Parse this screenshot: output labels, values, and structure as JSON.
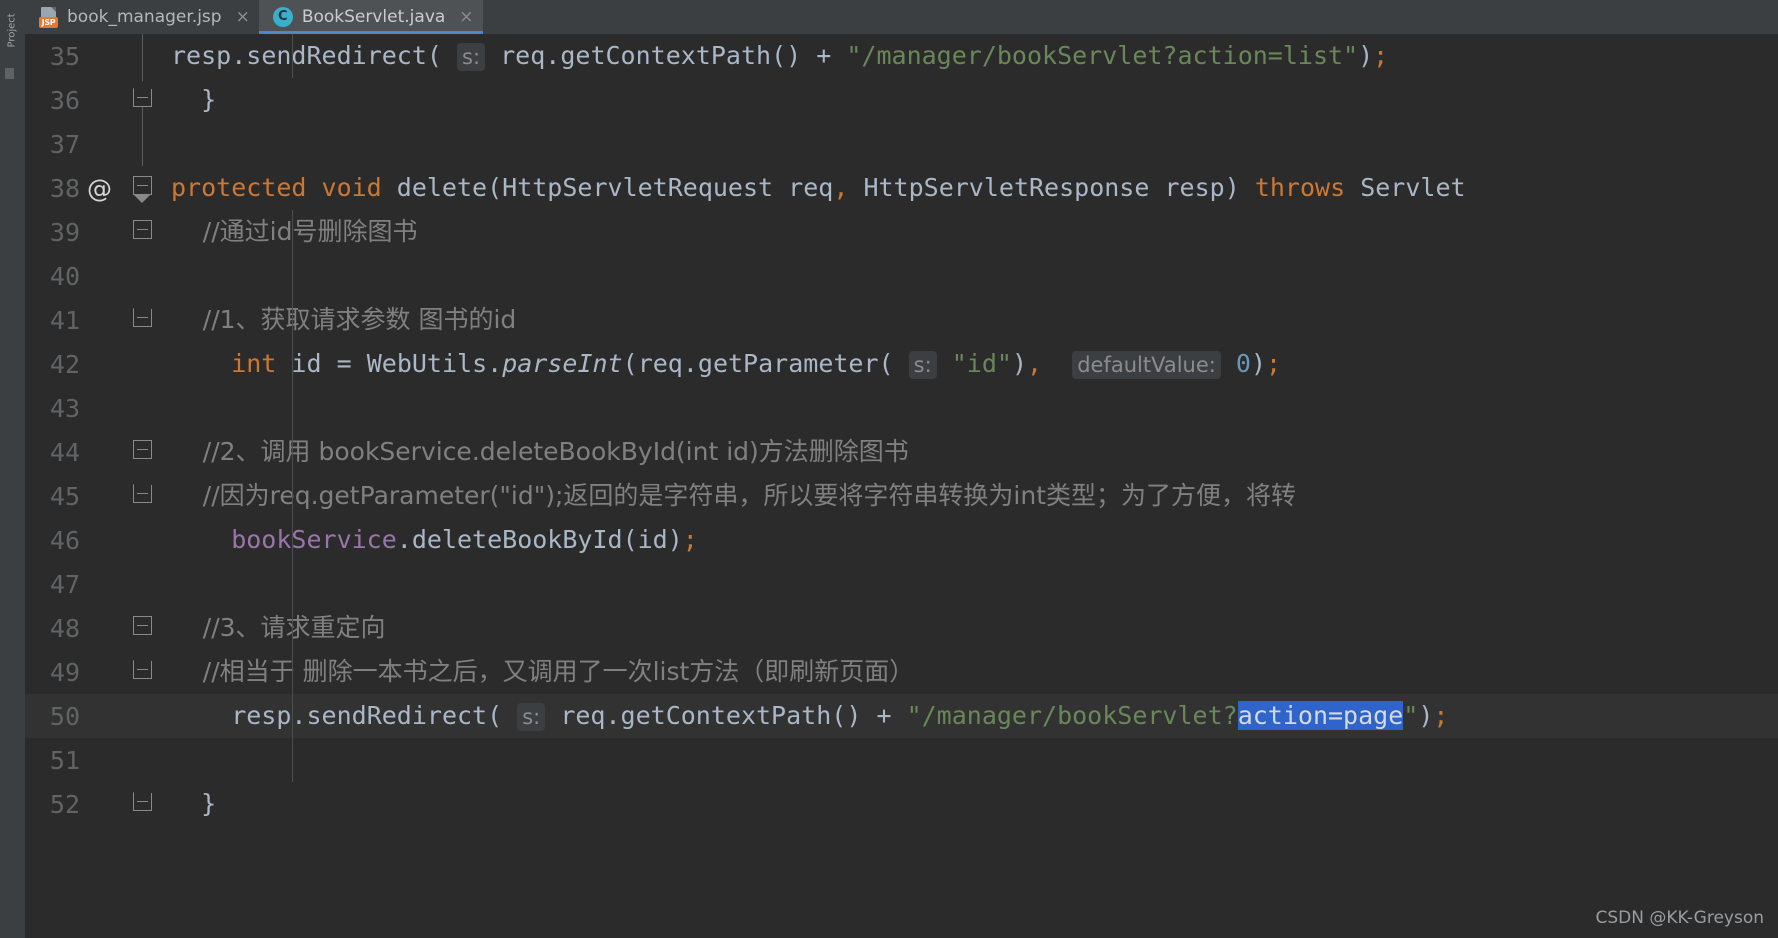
{
  "window": {
    "tool_stripe_label": "Project",
    "watermark": "CSDN @KK-Greyson"
  },
  "tabs": [
    {
      "label": "book_manager.jsp",
      "icon": "jsp-file-icon",
      "icon_text": "JSP",
      "close": "×",
      "active": false
    },
    {
      "label": "BookServlet.java",
      "icon": "java-class-icon",
      "icon_text": "C",
      "close": "×",
      "active": true
    }
  ],
  "colors": {
    "editor_background": "#2b2b2b",
    "tab_bar_background": "#3c3f41",
    "active_tab_background": "#4e5254",
    "active_tab_underline": "#4a88c7",
    "keyword": "#cc7832",
    "string": "#6a8759",
    "number": "#6897bb",
    "comment": "#808080",
    "identifier": "#a9b7c6",
    "field": "#9876aa",
    "line_number": "#616365",
    "selection": "#2f65ca",
    "inline_hint_background": "#3b3f41",
    "current_line": "#323232"
  },
  "editor": {
    "language": "java",
    "lines": [
      {
        "number": "35",
        "annotation": "",
        "fold": "line",
        "text": "        resp.sendRedirect( s: req.getContextPath() + \"/manager/bookServlet?action=list\");"
      },
      {
        "number": "36",
        "annotation": "",
        "fold": "house",
        "text": "    }"
      },
      {
        "number": "37",
        "annotation": "",
        "fold": "line",
        "text": ""
      },
      {
        "number": "38",
        "annotation": "@",
        "fold": "down",
        "text": "    protected void delete(HttpServletRequest req, HttpServletResponse resp) throws Servlet"
      },
      {
        "number": "39",
        "annotation": "",
        "fold": "down",
        "text": "        //通过id号删除图书"
      },
      {
        "number": "40",
        "annotation": "",
        "fold": "none",
        "text": ""
      },
      {
        "number": "41",
        "annotation": "",
        "fold": "house",
        "text": "        //1、获取请求参数 图书的id"
      },
      {
        "number": "42",
        "annotation": "",
        "fold": "none",
        "text": "        int id = WebUtils.parseInt(req.getParameter( s: \"id\"), defaultValue: 0);"
      },
      {
        "number": "43",
        "annotation": "",
        "fold": "none",
        "text": ""
      },
      {
        "number": "44",
        "annotation": "",
        "fold": "down",
        "text": "        //2、调用 bookService.deleteBookById(int id)方法删除图书"
      },
      {
        "number": "45",
        "annotation": "",
        "fold": "house",
        "text": "        //因为req.getParameter(\"id\");返回的是字符串，所以要将字符串转换为int类型；为了方便，将转"
      },
      {
        "number": "46",
        "annotation": "",
        "fold": "none",
        "text": "        bookService.deleteBookById(id);"
      },
      {
        "number": "47",
        "annotation": "",
        "fold": "none",
        "text": ""
      },
      {
        "number": "48",
        "annotation": "",
        "fold": "down",
        "text": "        //3、请求重定向"
      },
      {
        "number": "49",
        "annotation": "",
        "fold": "house",
        "text": "        //相当于 删除一本书之后，又调用了一次list方法（即刷新页面）"
      },
      {
        "number": "50",
        "annotation": "",
        "fold": "none",
        "current": true,
        "text": "        resp.sendRedirect( s: req.getContextPath() + \"/manager/bookServlet?action=page\");"
      },
      {
        "number": "51",
        "annotation": "",
        "fold": "none",
        "text": ""
      },
      {
        "number": "52",
        "annotation": "",
        "fold": "house",
        "text": "    }"
      }
    ],
    "selection": {
      "line": "50",
      "selected_text": "action=page"
    },
    "inline_hints": [
      {
        "line": "35",
        "label": "s:"
      },
      {
        "line": "42",
        "label": "s:"
      },
      {
        "line": "42",
        "label": "defaultValue:"
      },
      {
        "line": "50",
        "label": "s:"
      }
    ]
  }
}
